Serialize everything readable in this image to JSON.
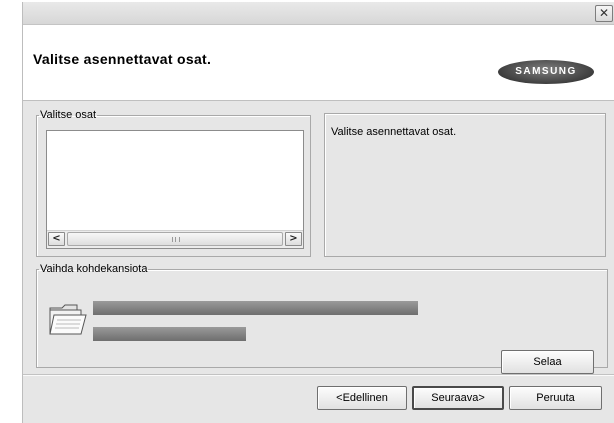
{
  "window": {
    "close_glyph": "✕"
  },
  "header": {
    "title": "Valitse asennettavat osat.",
    "logo_text": "SAMSUNG"
  },
  "components": {
    "legend": "Valitse osat",
    "items": [],
    "scroll_left": "<",
    "scroll_right": ">"
  },
  "description": {
    "text": "Valitse asennettavat osat."
  },
  "destination": {
    "legend": "Vaihda kohdekansiota",
    "icon": "folder-icon",
    "browse_label": "Selaa"
  },
  "footer": {
    "back_label": "<Edellinen",
    "next_label": "Seuraava>",
    "cancel_label": "Peruuta"
  },
  "colors": {
    "dialog_bg": "#e6e6e6",
    "header_bg": "#ffffff",
    "logo_bg": "#4a4a4a"
  }
}
